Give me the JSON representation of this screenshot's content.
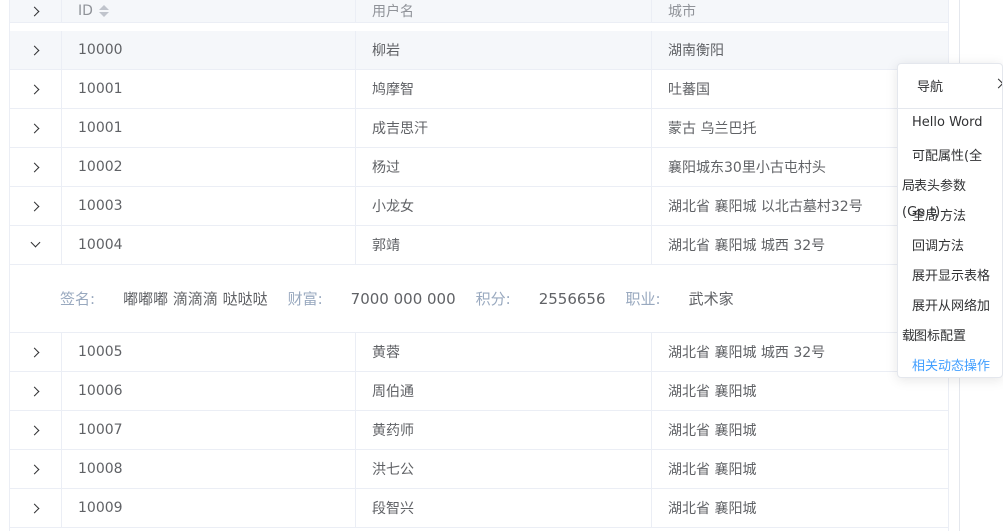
{
  "table": {
    "columns": {
      "id": "ID",
      "name": "用户名",
      "city": "城市"
    },
    "rows": [
      {
        "id": "10000",
        "name": "柳岩",
        "city": "湖南衡阳"
      },
      {
        "id": "10001",
        "name": "鸠摩智",
        "city": "吐蕃国"
      },
      {
        "id": "10001",
        "name": "成吉思汗",
        "city": "蒙古 乌兰巴托"
      },
      {
        "id": "10002",
        "name": "杨过",
        "city": "襄阳城东30里小古屯村头"
      },
      {
        "id": "10003",
        "name": "小龙女",
        "city": "湖北省 襄阳城 以北古墓村32号"
      },
      {
        "id": "10004",
        "name": "郭靖",
        "city": "湖北省 襄阳城 城西 32号"
      },
      {
        "id": "10005",
        "name": "黄蓉",
        "city": "湖北省 襄阳城 城西 32号"
      },
      {
        "id": "10006",
        "name": "周伯通",
        "city": "湖北省 襄阳城"
      },
      {
        "id": "10007",
        "name": "黄药师",
        "city": "湖北省 襄阳城"
      },
      {
        "id": "10008",
        "name": "洪七公",
        "city": "湖北省 襄阳城"
      },
      {
        "id": "10009",
        "name": "段智兴",
        "city": "湖北省 襄阳城"
      }
    ]
  },
  "expanded": {
    "signature_label": "签名:",
    "signature_value": "嘟嘟嘟 滴滴滴 哒哒哒",
    "wealth_label": "财富:",
    "wealth_value": "7000 000 000",
    "points_label": "积分:",
    "points_value": "2556656",
    "job_label": "职业:",
    "job_value": "武术家"
  },
  "menu": {
    "nav": "导航",
    "items": [
      "Hello Word",
      "可配属性(全",
      "局",
      "表头参数",
      "(Ge",
      "全局",
      "t)",
      "方法",
      "回调方法",
      "展开显示表格",
      "展开从网络加",
      "载",
      "图标配置",
      "相关动态操作"
    ]
  },
  "colors": {
    "accent": "#409eff",
    "header_bg": "#f5f7fa",
    "border": "#ebeef5"
  }
}
